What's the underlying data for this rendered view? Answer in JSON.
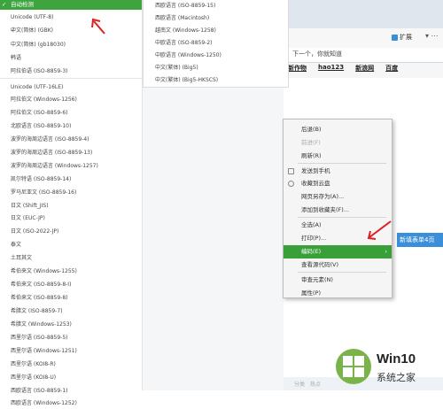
{
  "browser": {
    "address_text": "下一个，你就知道",
    "extensions_label": "扩展",
    "more_label": "▾ ⋯",
    "nav_links": [
      "新作物",
      "hao123",
      "新浪网",
      "百度"
    ],
    "search_button_label": "新填表单4页",
    "bottom_items": [
      "分类",
      "热点"
    ]
  },
  "encoding_menu": {
    "header": "自动检测",
    "left_items": [
      "Unicode (UTF-8)",
      "中文(简体) (GBK)",
      "中文(简体) (gb18030)",
      "韩语",
      "阿拉伯语 (ISO-8859-3)",
      "Unicode (UTF-16LE)",
      "阿拉伯文 (Windows-1256)",
      "阿拉伯文 (ISO-8859-6)",
      "北欧语言 (ISO-8859-10)",
      "波罗的海周边语言 (ISO-8859-4)",
      "波罗的海周边语言 (ISO-8859-13)",
      "波罗的海周边语言 (Windows-1257)",
      "凯尔特语 (ISO-8859-14)",
      "罗马尼亚文 (ISO-8859-16)",
      "日文 (Shift_JIS)",
      "日文 (EUC-JP)",
      "日文 (ISO-2022-JP)",
      "泰文",
      "土耳其文",
      "希伯来文 (Windows-1255)",
      "希伯来文 (ISO-8859-8-I)",
      "希伯来文 (ISO-8859-8)",
      "希腊文 (ISO-8859-7)",
      "希腊文 (Windows-1253)",
      "西里尔语 (ISO-8859-5)",
      "西里尔语 (Windows-1251)",
      "西里尔语 (KOI8-R)",
      "西里尔语 (KOI8-U)",
      "西欧语言 (ISO-8859-1)",
      "西欧语言 (Windows-1252)"
    ],
    "checked_item": "中文(简体) (GBK)",
    "right_items": [
      "西欧语言 (ISO-8859-15)",
      "西欧语言 (Macintosh)",
      "越南文 (Windows-1258)",
      "中欧语言 (ISO-8859-2)",
      "中欧语言 (Windows-1250)",
      "中文(繁体) (Big5)",
      "中文(繁体) (Big5-HKSCS)"
    ]
  },
  "context_menu": {
    "items": [
      {
        "label": "后退(B)",
        "disabled": false,
        "icon": ""
      },
      {
        "label": "前进(F)",
        "disabled": true,
        "icon": ""
      },
      {
        "label": "刷新(R)",
        "disabled": false,
        "icon": ""
      },
      {
        "label": "发送到手机",
        "disabled": false,
        "icon": "phone-icon"
      },
      {
        "label": "收藏到云盘",
        "disabled": false,
        "icon": "cloud-icon"
      },
      {
        "label": "网页另存为(A)...",
        "disabled": false,
        "icon": ""
      },
      {
        "label": "添加到收藏夹(F)...",
        "disabled": false,
        "icon": ""
      },
      {
        "label": "全选(A)",
        "disabled": false,
        "icon": ""
      },
      {
        "label": "打印(P)...",
        "disabled": false,
        "icon": ""
      },
      {
        "label": "编码(E)",
        "disabled": false,
        "icon": "",
        "highlighted": true
      },
      {
        "label": "查看源代码(V)",
        "disabled": false,
        "icon": ""
      },
      {
        "label": "审查元素(N)",
        "disabled": false,
        "icon": ""
      },
      {
        "label": "属性(P)",
        "disabled": false,
        "icon": ""
      }
    ],
    "highlight_color": "#39a039"
  },
  "watermark": {
    "title": "Win10",
    "subtitle": "系统之家"
  },
  "colors": {
    "accent_green": "#3ea53e",
    "arrow_red": "#e02020",
    "link_blue": "#3b8fd9"
  }
}
